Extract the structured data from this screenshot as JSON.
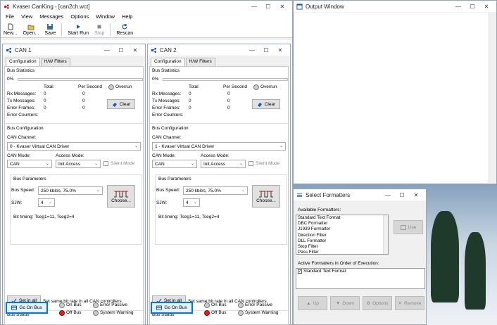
{
  "app": {
    "title": "Kvaser CanKing - [can2ch.wct]",
    "menu": [
      "File",
      "View",
      "Messages",
      "Options",
      "Window",
      "Help"
    ],
    "toolbar": [
      {
        "label": "New...",
        "icon": "new-file-icon",
        "enabled": true
      },
      {
        "label": "Open...",
        "icon": "open-folder-icon",
        "enabled": true
      },
      {
        "label": "Save",
        "icon": "save-icon",
        "enabled": true
      },
      {
        "label": "Start Run",
        "icon": "play-icon",
        "enabled": true
      },
      {
        "label": "Stop",
        "icon": "stop-icon",
        "enabled": false
      },
      {
        "label": "Rescan",
        "icon": "refresh-icon",
        "enabled": true
      }
    ],
    "window_controls": {
      "minimize": "—",
      "maximize": "☐",
      "close": "✕"
    }
  },
  "can_windows": [
    {
      "title": "CAN 1",
      "tabs": [
        "Configuration",
        "H/W Filters"
      ],
      "bus_statistics": {
        "title": "Bus Statistics",
        "load": "0%",
        "col_total": "Total",
        "col_per_second": "Per Second",
        "overrun": "Overrun",
        "rows": [
          {
            "label": "Rx Messages:",
            "total": "0",
            "per_second": "0"
          },
          {
            "label": "Tx Messages:",
            "total": "0",
            "per_second": "0"
          },
          {
            "label": "Error Frames:",
            "total": "0",
            "per_second": "0"
          },
          {
            "label": "Error Counters:",
            "total": "",
            "per_second": ""
          }
        ],
        "clear": "Clear"
      },
      "bus_config": {
        "title": "Bus Configuration",
        "channel_label": "CAN Channel:",
        "channel": "0 - Kvaser Virtual CAN Driver",
        "mode_label": "CAN Mode:",
        "mode": "CAN",
        "access_label": "Access Mode:",
        "access": "Init Access",
        "silent": "Silent Mode",
        "params_title": "Bus Parameters",
        "speed_label": "Bus Speed:",
        "speed": "250 kbit/s, 75.0%",
        "sjw_label": "SJW:",
        "sjw": "4",
        "choose": "Choose...",
        "timing": "Bit timing:  Tseg1=11, Tseg2=4",
        "set_in_all": "Set in all",
        "set_in_all_desc": "Set same bit rate in all CAN controllers"
      },
      "bus_status": {
        "title": "Bus Status",
        "go_on_bus": "Go On Bus",
        "on_bus": "On Bus",
        "off_bus": "Off Bus",
        "error_passive": "Error Passive",
        "system_warning": "System Warning"
      }
    },
    {
      "title": "CAN 2",
      "tabs": [
        "Configuration",
        "H/W Filters"
      ],
      "bus_statistics": {
        "title": "Bus Statistics",
        "load": "0%",
        "col_total": "Total",
        "col_per_second": "Per Second",
        "overrun": "Overrun",
        "rows": [
          {
            "label": "Rx Messages:",
            "total": "0",
            "per_second": "0"
          },
          {
            "label": "Tx Messages:",
            "total": "0",
            "per_second": "0"
          },
          {
            "label": "Error Frames:",
            "total": "0",
            "per_second": "0"
          },
          {
            "label": "Error Counters:",
            "total": "",
            "per_second": ""
          }
        ],
        "clear": "Clear"
      },
      "bus_config": {
        "title": "Bus Configuration",
        "channel_label": "CAN Channel:",
        "channel": "1 - Kvaser Virtual CAN Driver",
        "mode_label": "CAN Mode:",
        "mode": "CAN",
        "access_label": "Access Mode:",
        "access": "Init Access",
        "silent": "Silent Mode",
        "params_title": "Bus Parameters",
        "speed_label": "Bus Speed:",
        "speed": "250 kbit/s, 75.0%",
        "sjw_label": "SJW:",
        "sjw": "4",
        "choose": "Choose...",
        "timing": "Bit timing:  Tseg1=11, Tseg2=4",
        "set_in_all": "Set in all",
        "set_in_all_desc": "Set same bit rate in all CAN controllers"
      },
      "bus_status": {
        "title": "Bus Status",
        "go_on_bus": "Go On Bus",
        "on_bus": "On Bus",
        "off_bus": "Off Bus",
        "error_passive": "Error Passive",
        "system_warning": "System Warning"
      }
    }
  ],
  "output_window": {
    "title": "Output Window"
  },
  "formatters": {
    "title": "Select Formatters",
    "available_label": "Available Formatters:",
    "available": [
      "Standard Text Format",
      "DBC Formatter",
      "J1939 Formatter",
      "Direction Filter",
      "DLL Formatter",
      "Stop Filter",
      "Pass Filter"
    ],
    "use": "Use",
    "active_label": "Active Formatters in Order of Execution:",
    "active": [
      "Standard Text Format"
    ],
    "buttons": [
      "Up",
      "Down",
      "Options",
      "Remove"
    ]
  },
  "colors": {
    "accent": "#0078d7",
    "off_bus": "#e02020",
    "title_red": "#c8102e"
  }
}
